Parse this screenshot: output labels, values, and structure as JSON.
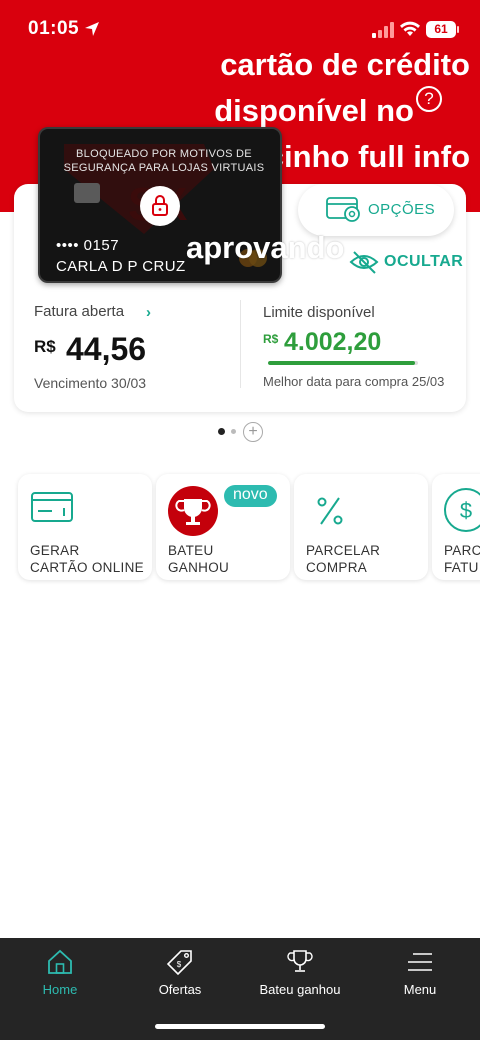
{
  "status_bar": {
    "time": "01:05",
    "battery": "61"
  },
  "overlay": {
    "lines": [
      "cartão de crédito",
      "disponível no",
      "precinho full info"
    ],
    "bottom_line": "aprovando",
    "help_glyph": "?"
  },
  "card": {
    "blocked_message": "BLOQUEADO POR MOTIVOS DE SEGURANÇA PARA LOJAS VIRTUAIS",
    "number": "•••• 0157",
    "holder": "CARLA D P CRUZ"
  },
  "actions": {
    "options_label": "OPÇÕES",
    "hide_label": "OCULTAR"
  },
  "invoice": {
    "label": "Fatura aberta",
    "chevron": "›",
    "currency": "R$",
    "amount": "44,56",
    "due": "Vencimento 30/03"
  },
  "limit": {
    "label": "Limite disponível",
    "currency": "R$",
    "amount": "4.002,20",
    "usage_fraction": 0.98,
    "best_date": "Melhor data para compra 25/03"
  },
  "pager": {
    "add_glyph": "+"
  },
  "shortcuts": [
    {
      "label_line1": "GERAR",
      "label_line2": "CARTÃO ONLINE",
      "icon": "card-icon"
    },
    {
      "label_line1": "BATEU",
      "label_line2": "GANHOU",
      "icon": "trophy-icon",
      "badge": "novo"
    },
    {
      "label_line1": "PARCELAR",
      "label_line2": "COMPRA",
      "icon": "percent-icon"
    },
    {
      "label_line1": "PARC",
      "label_line2": "FATU",
      "icon": "dollar-icon"
    }
  ],
  "bottom_nav": [
    {
      "label": "Home",
      "icon": "home-icon",
      "active": true
    },
    {
      "label": "Ofertas",
      "icon": "tag-icon"
    },
    {
      "label": "Bateu ganhou",
      "icon": "trophy-icon"
    },
    {
      "label": "Menu",
      "icon": "menu-icon"
    }
  ],
  "colors": {
    "brand_red": "#d9000d",
    "accent_teal": "#17a98f",
    "limit_green": "#2e9e3c",
    "nav_bg": "#252525"
  }
}
